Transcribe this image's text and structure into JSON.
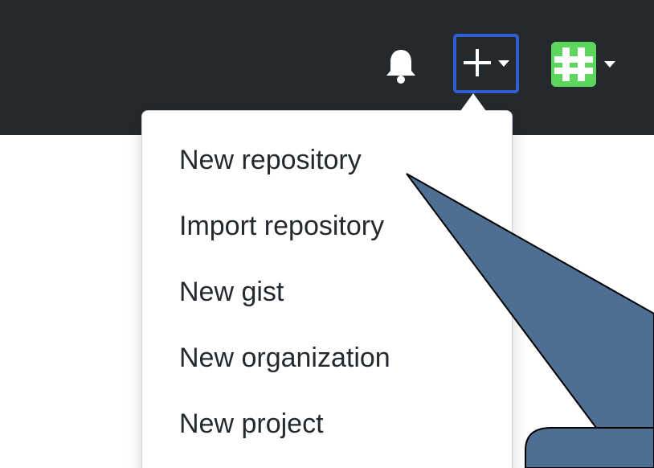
{
  "header": {
    "notifications_icon": "bell-icon",
    "create_button": {
      "icon": "plus-icon",
      "dropdown_icon": "caret-down-icon",
      "accent_color": "#2f5fd0"
    },
    "user_avatar": {
      "icon": "identicon",
      "dropdown_icon": "caret-down-icon",
      "color": "#5cd65c"
    }
  },
  "create_menu": {
    "items": [
      {
        "label": "New repository"
      },
      {
        "label": "Import repository"
      },
      {
        "label": "New gist"
      },
      {
        "label": "New organization"
      },
      {
        "label": "New project"
      }
    ]
  },
  "callout": {
    "fill_color": "#4d6f93"
  }
}
